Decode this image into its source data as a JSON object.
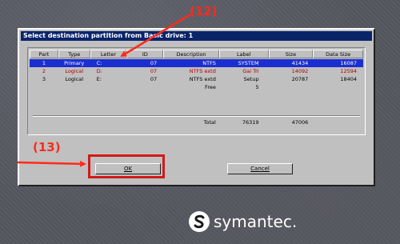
{
  "window": {
    "title": "Select destination partition from Basic drive: 1"
  },
  "table": {
    "columns": [
      "Part",
      "Type",
      "Letter",
      "ID",
      "Description",
      "Label",
      "Size",
      "Data Size"
    ],
    "rows": [
      {
        "part": "1",
        "type": "Primary",
        "letter": "C:",
        "id": "07",
        "description": "NTFS",
        "label": "SYSTEM",
        "size": "41434",
        "data_size": "16087",
        "selected": true
      },
      {
        "part": "2",
        "type": "Logical",
        "letter": "D:",
        "id": "07",
        "description": "NTFS extd",
        "label": "Gai Tri",
        "size": "14092",
        "data_size": "12594",
        "highlight": "red"
      },
      {
        "part": "3",
        "type": "Logical",
        "letter": "E:",
        "id": "07",
        "description": "NTFS extd",
        "label": "Setup",
        "size": "20787",
        "data_size": "18404"
      },
      {
        "part": "",
        "type": "",
        "letter": "",
        "id": "",
        "description": "Free",
        "label": "5",
        "size": "",
        "data_size": ""
      }
    ],
    "total": {
      "label": "Total",
      "size": "76319",
      "data_size": "47006"
    }
  },
  "buttons": {
    "ok": "OK",
    "cancel": "Cancel"
  },
  "annotations": {
    "step12": "(12)",
    "step13": "(13)"
  },
  "brand": {
    "name": "symantec."
  },
  "colors": {
    "selection": "#1b2fd0",
    "title_bar": "#0a246a",
    "annotation": "#ff2a1a",
    "dialog_bg": "#c0c0c0"
  }
}
